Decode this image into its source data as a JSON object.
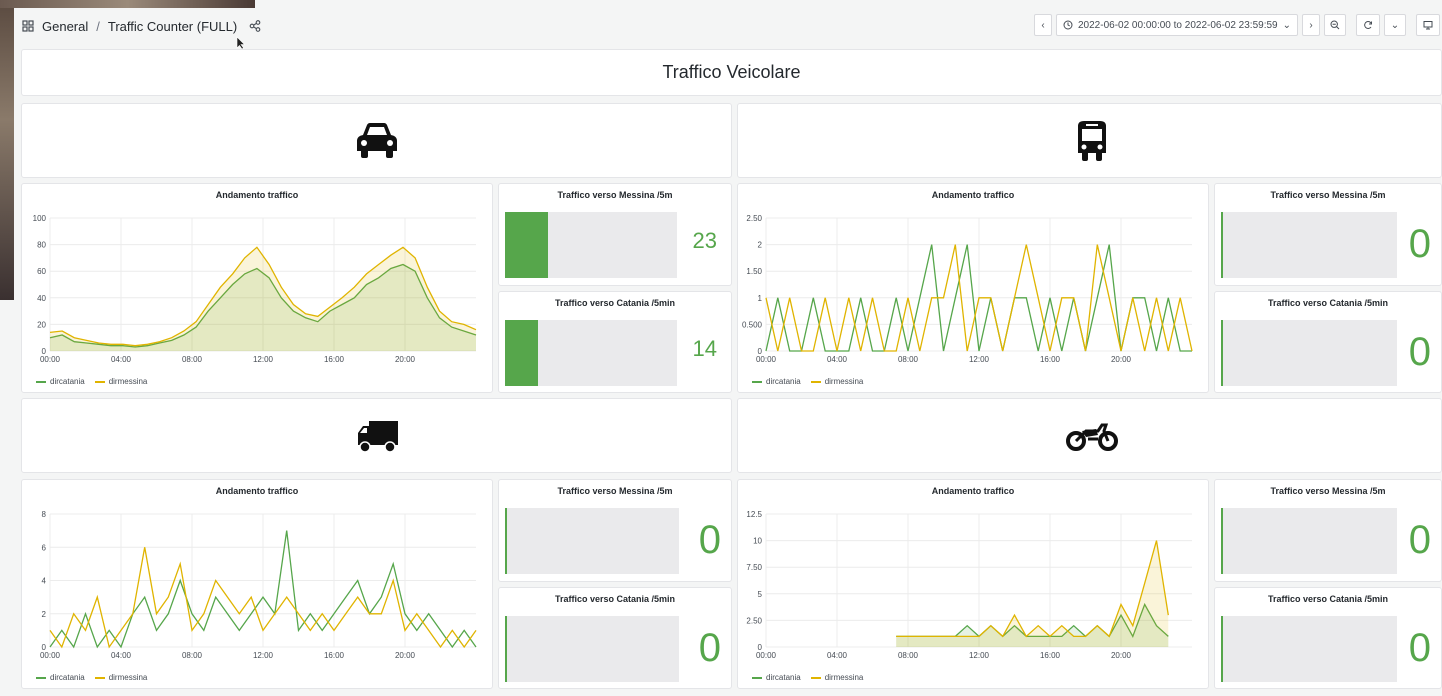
{
  "breadcrumb": {
    "folder": "General",
    "separator": "/",
    "dashboard": "Traffic Counter (FULL)"
  },
  "time_range": "2022-06-02 00:00:00 to 2022-06-02 23:59:59",
  "main_title": "Traffico Veicolare",
  "colors": {
    "green": "#56a64b",
    "yellow": "#e0b400"
  },
  "vehicle_icons": [
    "car-icon",
    "bus-icon",
    "truck-icon",
    "motorcycle-icon"
  ],
  "chart_title": "Andamento traffico",
  "stat_messina_title": "Traffico verso Messina /5m",
  "stat_catania_title": "Traffico verso Catania /5min",
  "legend": {
    "dircatania": "dircatania",
    "dirmessina": "dirmessina"
  },
  "stats": {
    "car": {
      "messina": "23",
      "catania": "14",
      "messina_frac": 0.25,
      "catania_frac": 0.19
    },
    "bus": {
      "messina": "0",
      "catania": "0"
    },
    "truck": {
      "messina": "0",
      "catania": "0"
    },
    "moto": {
      "messina": "0",
      "catania": "0"
    }
  },
  "chart_data": [
    {
      "type": "area",
      "name": "car",
      "yticks": [
        "0",
        "20",
        "40",
        "60",
        "80",
        "100"
      ],
      "ylim": [
        0,
        100
      ],
      "x": [
        "00:00",
        "04:00",
        "08:00",
        "12:00",
        "16:00",
        "20:00"
      ],
      "series": [
        {
          "name": "dircatania",
          "values": [
            10,
            12,
            7,
            6,
            5,
            4,
            4,
            3,
            4,
            6,
            8,
            12,
            18,
            30,
            40,
            50,
            58,
            62,
            55,
            40,
            30,
            25,
            22,
            30,
            35,
            40,
            50,
            55,
            62,
            65,
            60,
            40,
            25,
            18,
            15,
            12
          ]
        },
        {
          "name": "dirmessina",
          "values": [
            14,
            15,
            10,
            8,
            6,
            5,
            5,
            4,
            5,
            7,
            10,
            15,
            22,
            35,
            48,
            58,
            70,
            78,
            65,
            48,
            35,
            28,
            26,
            33,
            40,
            48,
            58,
            65,
            72,
            78,
            70,
            48,
            30,
            22,
            20,
            16
          ]
        }
      ]
    },
    {
      "type": "line",
      "name": "bus",
      "yticks": [
        "0",
        "0.500",
        "1",
        "1.50",
        "2",
        "2.50"
      ],
      "ylim": [
        0,
        2.5
      ],
      "x": [
        "00:00",
        "04:00",
        "08:00",
        "12:00",
        "16:00",
        "20:00"
      ],
      "series": [
        {
          "name": "dircatania",
          "values": [
            0,
            1,
            0,
            0,
            1,
            0,
            0,
            0,
            1,
            0,
            0,
            1,
            0,
            1,
            2,
            0,
            1,
            2,
            0,
            1,
            0,
            1,
            1,
            0,
            1,
            0,
            1,
            0,
            1,
            2,
            0,
            1,
            1,
            0,
            1,
            0,
            0
          ]
        },
        {
          "name": "dirmessina",
          "values": [
            1,
            0,
            1,
            0,
            0,
            1,
            0,
            1,
            0,
            1,
            0,
            0,
            1,
            0,
            1,
            1,
            2,
            0,
            1,
            1,
            0,
            1,
            2,
            1,
            0,
            1,
            1,
            0,
            2,
            1,
            0,
            1,
            0,
            1,
            0,
            1,
            0
          ]
        }
      ]
    },
    {
      "type": "line",
      "name": "truck",
      "yticks": [
        "0",
        "2",
        "4",
        "6",
        "8"
      ],
      "ylim": [
        0,
        8
      ],
      "x": [
        "00:00",
        "04:00",
        "08:00",
        "12:00",
        "16:00",
        "20:00"
      ],
      "series": [
        {
          "name": "dircatania",
          "values": [
            0,
            1,
            0,
            2,
            0,
            1,
            0,
            2,
            3,
            1,
            2,
            4,
            2,
            1,
            3,
            2,
            1,
            2,
            3,
            2,
            7,
            1,
            2,
            1,
            2,
            3,
            4,
            2,
            3,
            5,
            2,
            1,
            2,
            1,
            0,
            1,
            0
          ]
        },
        {
          "name": "dirmessina",
          "values": [
            1,
            0,
            2,
            1,
            3,
            0,
            1,
            2,
            6,
            2,
            3,
            5,
            1,
            2,
            4,
            3,
            2,
            3,
            1,
            2,
            3,
            2,
            1,
            2,
            1,
            2,
            3,
            2,
            2,
            4,
            1,
            2,
            1,
            0,
            1,
            0,
            1
          ]
        }
      ]
    },
    {
      "type": "area",
      "name": "moto",
      "yticks": [
        "0",
        "2.50",
        "5",
        "7.50",
        "10",
        "12.5"
      ],
      "ylim": [
        0,
        12.5
      ],
      "x": [
        "00:00",
        "04:00",
        "08:00",
        "12:00",
        "16:00",
        "20:00"
      ],
      "series": [
        {
          "name": "dircatania",
          "values": [
            null,
            null,
            null,
            null,
            null,
            null,
            null,
            null,
            null,
            null,
            null,
            1,
            1,
            1,
            1,
            1,
            1,
            2,
            1,
            2,
            1,
            2,
            1,
            1,
            1,
            1,
            2,
            1,
            2,
            1,
            3,
            1,
            4,
            2,
            1,
            null,
            null
          ]
        },
        {
          "name": "dirmessina",
          "values": [
            null,
            null,
            null,
            null,
            null,
            null,
            null,
            null,
            null,
            null,
            null,
            1,
            1,
            1,
            1,
            1,
            1,
            1,
            1,
            2,
            1,
            3,
            1,
            2,
            1,
            2,
            1,
            1,
            2,
            1,
            4,
            2,
            6,
            10,
            3,
            null,
            null
          ]
        }
      ]
    }
  ]
}
